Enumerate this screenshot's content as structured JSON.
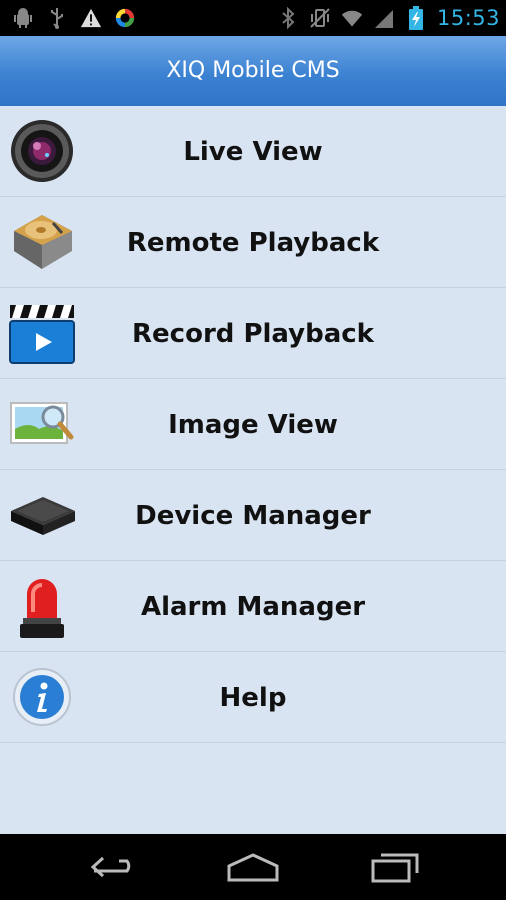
{
  "status_bar": {
    "left_icons": [
      "android-debug-icon",
      "usb-icon",
      "warning-icon",
      "sync-app-icon"
    ],
    "right_icons": [
      "bluetooth-icon",
      "vibrate-icon",
      "wifi-icon",
      "signal-icon",
      "battery-charging-icon"
    ],
    "time": "15:53",
    "time_color": "#33b5e5"
  },
  "header": {
    "title": "XIQ Mobile CMS",
    "color": "#3c82d2"
  },
  "menu": {
    "items": [
      {
        "label": "Live View",
        "icon": "camera-lens-icon"
      },
      {
        "label": "Remote Playback",
        "icon": "hard-disk-icon"
      },
      {
        "label": "Record Playback",
        "icon": "clapperboard-icon"
      },
      {
        "label": "Image View",
        "icon": "image-search-icon"
      },
      {
        "label": "Device Manager",
        "icon": "dvr-box-icon"
      },
      {
        "label": "Alarm Manager",
        "icon": "alarm-siren-icon"
      },
      {
        "label": "Help",
        "icon": "info-icon"
      }
    ]
  },
  "nav_bar": {
    "buttons": [
      "back-icon",
      "home-icon",
      "recent-apps-icon"
    ]
  }
}
